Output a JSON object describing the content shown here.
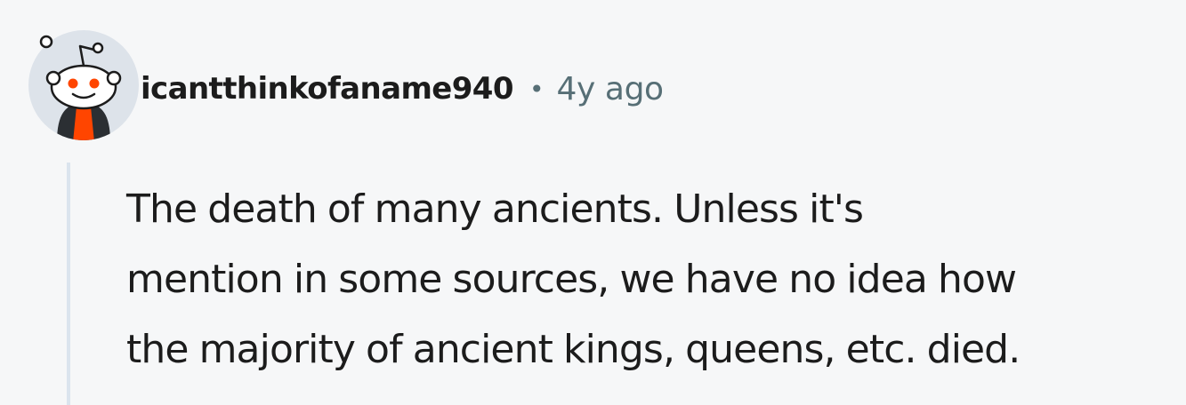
{
  "comment": {
    "avatar_icon": "snoo-avatar-icon",
    "username": "icantthinkofaname940",
    "separator": "•",
    "timestamp": "4y ago",
    "body_lines": [
      "The death of many ancients. Unless it's",
      "mention in some sources, we have no idea how",
      "the majority of ancient kings, queens, etc. died."
    ]
  },
  "colors": {
    "background": "#f6f7f8",
    "text": "#1c1c1c",
    "meta": "#576f76",
    "thread_line": "#dbe4ee",
    "avatar_bg": "#dde3ea",
    "accent": "#ff4500"
  }
}
